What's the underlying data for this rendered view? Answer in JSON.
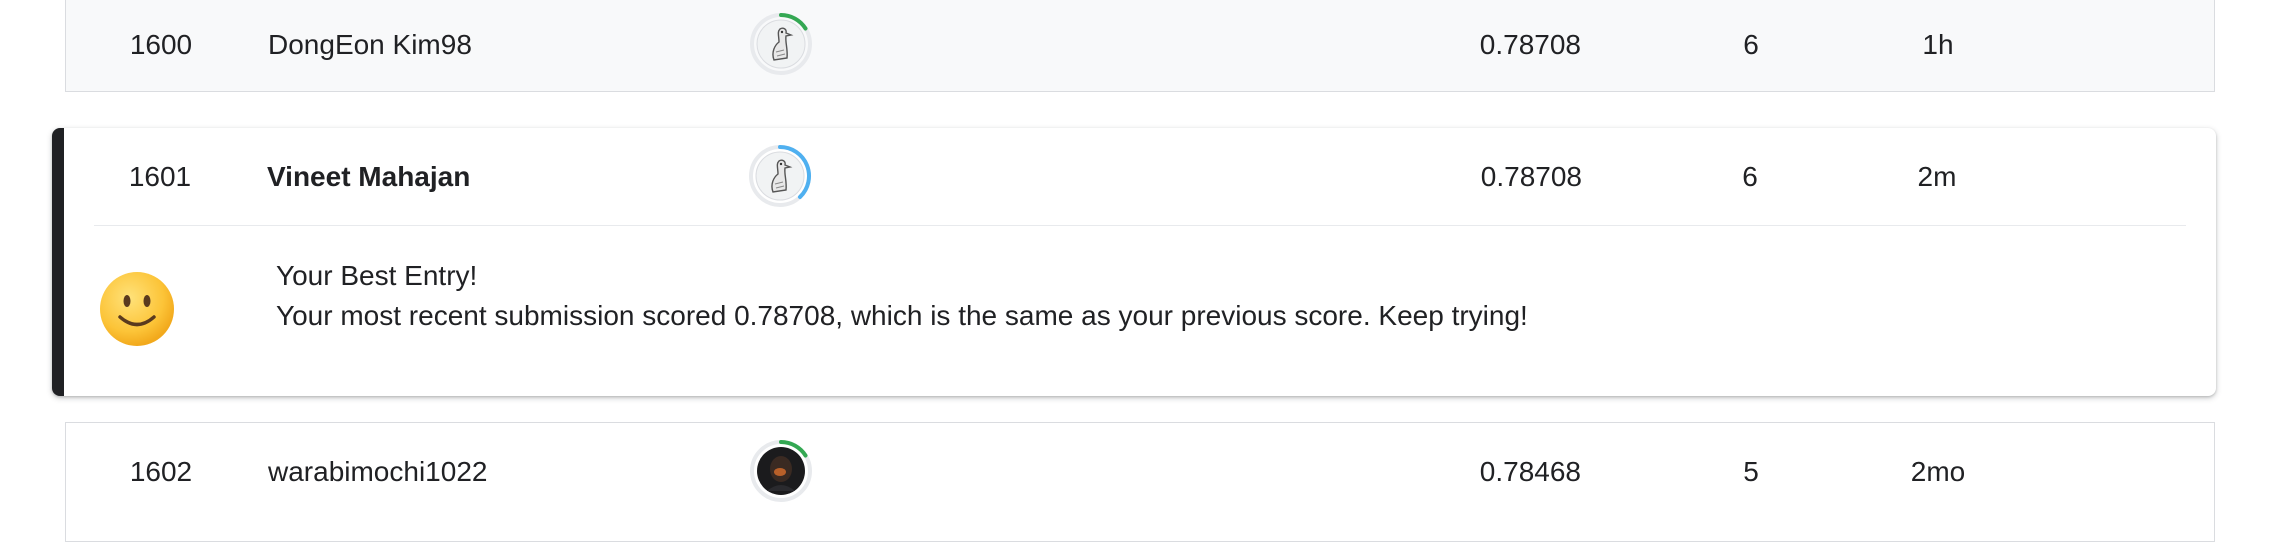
{
  "rows": [
    {
      "rank": "1600",
      "name": "DongEon Kim98",
      "score": "0.78708",
      "entries": "6",
      "last": "1h",
      "tier_progress": 0.2,
      "tier_color": "#34a853"
    },
    {
      "rank": "1601",
      "name": "Vineet Mahajan",
      "score": "0.78708",
      "entries": "6",
      "last": "2m",
      "tier_progress": 0.45,
      "tier_color": "#4fb0f0"
    },
    {
      "rank": "1602",
      "name": "warabimochi1022",
      "score": "0.78468",
      "entries": "5",
      "last": "2mo",
      "tier_progress": 0.2,
      "tier_color": "#34a853"
    }
  ],
  "best_entry": {
    "title": "Your Best Entry!",
    "message": "Your most recent submission scored 0.78708, which is the same as your previous score. Keep trying!",
    "emoji_icon": "slightly-smiling-face-icon"
  },
  "colors": {
    "highlight_bar": "#202124",
    "progress_green": "#34a853",
    "progress_blue": "#4fb0f0"
  }
}
